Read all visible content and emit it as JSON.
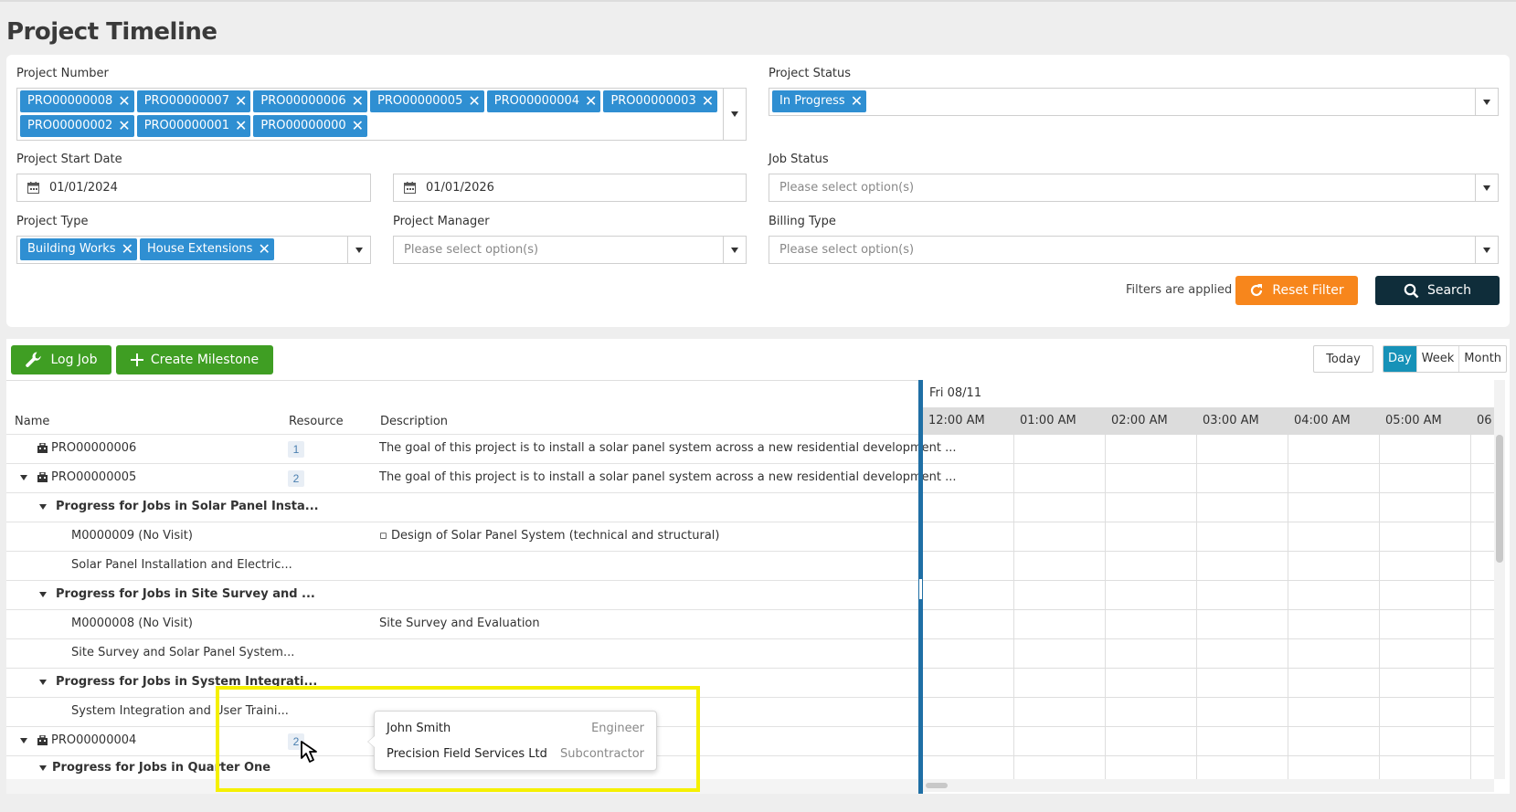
{
  "page": {
    "title": "Project Timeline"
  },
  "filters": {
    "project_number": {
      "label": "Project Number",
      "chips": [
        "PRO00000008",
        "PRO00000007",
        "PRO00000006",
        "PRO00000005",
        "PRO00000004",
        "PRO00000003",
        "PRO00000002",
        "PRO00000001",
        "PRO00000000"
      ]
    },
    "project_status": {
      "label": "Project Status",
      "chips": [
        "In Progress"
      ]
    },
    "project_start_date": {
      "label": "Project Start Date",
      "from": "01/01/2024",
      "to": "01/01/2026"
    },
    "job_status": {
      "label": "Job Status",
      "placeholder": "Please select option(s)"
    },
    "project_type": {
      "label": "Project Type",
      "chips": [
        "Building Works",
        "House Extensions"
      ]
    },
    "project_manager": {
      "label": "Project Manager",
      "placeholder": "Please select option(s)"
    },
    "billing_type": {
      "label": "Billing Type",
      "placeholder": "Please select option(s)"
    },
    "applied_text": "Filters are applied",
    "reset_label": "Reset Filter",
    "search_label": "Search"
  },
  "toolbar": {
    "log_job_label": "Log Job",
    "create_milestone_label": "Create Milestone",
    "today_label": "Today",
    "views": [
      "Day",
      "Week",
      "Month"
    ],
    "active_view": "Day"
  },
  "grid": {
    "columns": {
      "name": "Name",
      "resource": "Resource",
      "description": "Description"
    },
    "rows": [
      {
        "name": "PRO00000006",
        "resource": "1",
        "description": "The goal of this project is to install a solar panel system across a new residential development ..."
      },
      {
        "name": "PRO00000005",
        "resource": "2",
        "description": "The goal of this project is to install a solar panel system across a new residential development ..."
      },
      {
        "name": "Progress for Jobs in Solar Panel Insta...",
        "resource": "",
        "description": ""
      },
      {
        "name": "M0000009 (No Visit)",
        "resource": "",
        "description": "▫ Design of Solar Panel System (technical and structural)"
      },
      {
        "name": "Solar Panel Installation and Electric...",
        "resource": "",
        "description": ""
      },
      {
        "name": "Progress for Jobs in Site Survey and ...",
        "resource": "",
        "description": ""
      },
      {
        "name": "M0000008 (No Visit)",
        "resource": "",
        "description": "Site Survey and Evaluation"
      },
      {
        "name": "Site Survey and Solar Panel System...",
        "resource": "",
        "description": ""
      },
      {
        "name": "Progress for Jobs in System Integrati...",
        "resource": "",
        "description": ""
      },
      {
        "name": "System Integration and User Traini...",
        "resource": "",
        "description": ""
      },
      {
        "name": "PRO00000004",
        "resource": "2",
        "description": ""
      },
      {
        "name": "Progress for Jobs in Quarter One",
        "resource": "",
        "description": ""
      }
    ]
  },
  "timeline": {
    "date": "Fri 08/11",
    "hours": [
      "12:00 AM",
      "01:00 AM",
      "02:00 AM",
      "03:00 AM",
      "04:00 AM",
      "05:00 AM",
      "06"
    ]
  },
  "resource_popup": {
    "items": [
      {
        "name": "John Smith",
        "role": "Engineer"
      },
      {
        "name": "Precision Field Services Ltd",
        "role": "Subcontractor"
      }
    ]
  },
  "colors": {
    "chip": "#2f8fd2",
    "reset": "#f7861c",
    "search": "#0f2d3a",
    "green": "#3f9e23",
    "active_view": "#1692b8",
    "highlight": "#f5f000"
  }
}
